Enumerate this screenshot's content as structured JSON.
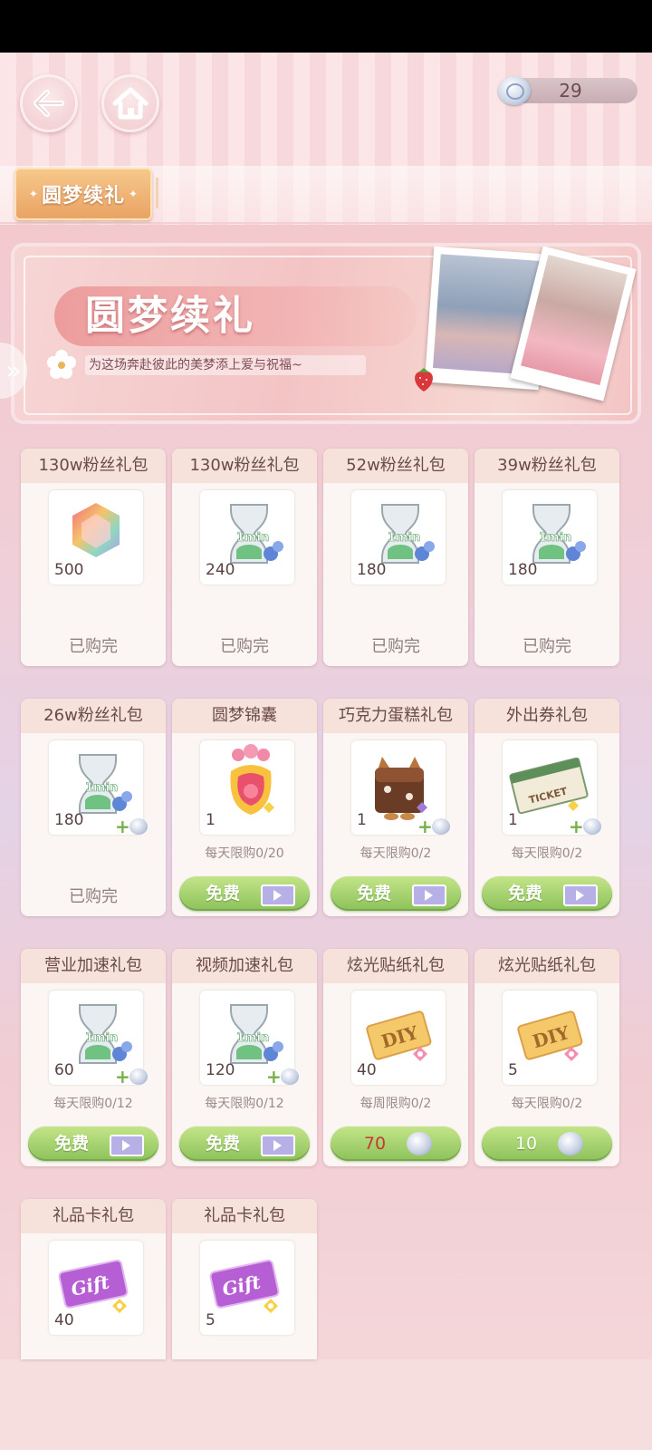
{
  "header": {
    "back_icon": "back-arrow-icon",
    "home_icon": "home-icon",
    "currency": {
      "icon": "silver-coin-icon",
      "amount": "29"
    }
  },
  "tabs": [
    {
      "label": "圆梦续礼",
      "active": true
    }
  ],
  "banner": {
    "title": "圆梦续礼",
    "subtitle": "为这场奔赴彼此的美梦添上爱与祝福~"
  },
  "packs": [
    {
      "name": "130w粉丝礼包",
      "item_icon": "rainbow-gem-icon",
      "count": "500",
      "status": "已购完"
    },
    {
      "name": "130w粉丝礼包",
      "item_icon": "hourglass-icon",
      "count": "240",
      "status": "已购完"
    },
    {
      "name": "52w粉丝礼包",
      "item_icon": "hourglass-icon",
      "count": "180",
      "status": "已购完"
    },
    {
      "name": "39w粉丝礼包",
      "item_icon": "hourglass-icon",
      "count": "180",
      "status": "已购完"
    },
    {
      "name": "26w粉丝礼包",
      "item_icon": "hourglass-icon",
      "count": "180",
      "status": "已购完"
    },
    {
      "name": "圆梦锦囊",
      "item_icon": "lucky-pouch-icon",
      "count": "1",
      "limit": "每天限购0/20",
      "button": "免费"
    },
    {
      "name": "巧克力蛋糕礼包",
      "item_icon": "chocolate-cake-icon",
      "count": "1",
      "limit": "每天限购0/2",
      "button": "免费"
    },
    {
      "name": "外出券礼包",
      "item_icon": "ticket-icon",
      "count": "1",
      "limit": "每天限购0/2",
      "button": "免费"
    },
    {
      "name": "营业加速礼包",
      "item_icon": "hourglass-icon",
      "count": "60",
      "limit": "每天限购0/12",
      "button": "免费"
    },
    {
      "name": "视频加速礼包",
      "item_icon": "hourglass-icon",
      "count": "120",
      "limit": "每天限购0/12",
      "button": "免费"
    },
    {
      "name": "炫光贴纸礼包",
      "item_icon": "diy-sticker-icon",
      "count": "40",
      "limit": "每周限购0/2",
      "price": "70"
    },
    {
      "name": "炫光贴纸礼包",
      "item_icon": "diy-sticker-icon",
      "count": "5",
      "limit": "每天限购0/2",
      "price": "10"
    },
    {
      "name": "礼品卡礼包",
      "item_icon": "gift-card-icon",
      "count": "40"
    },
    {
      "name": "礼品卡礼包",
      "item_icon": "gift-card-icon",
      "count": "5"
    }
  ],
  "hourglass_tag": "1min",
  "gift_card_text": "Gift",
  "diy_text": "DIY",
  "ticket_text": "TICKET",
  "colors": {
    "free_button": "#8cc25a",
    "tab_active": "#e9a262",
    "price_red": "#c23b30"
  }
}
